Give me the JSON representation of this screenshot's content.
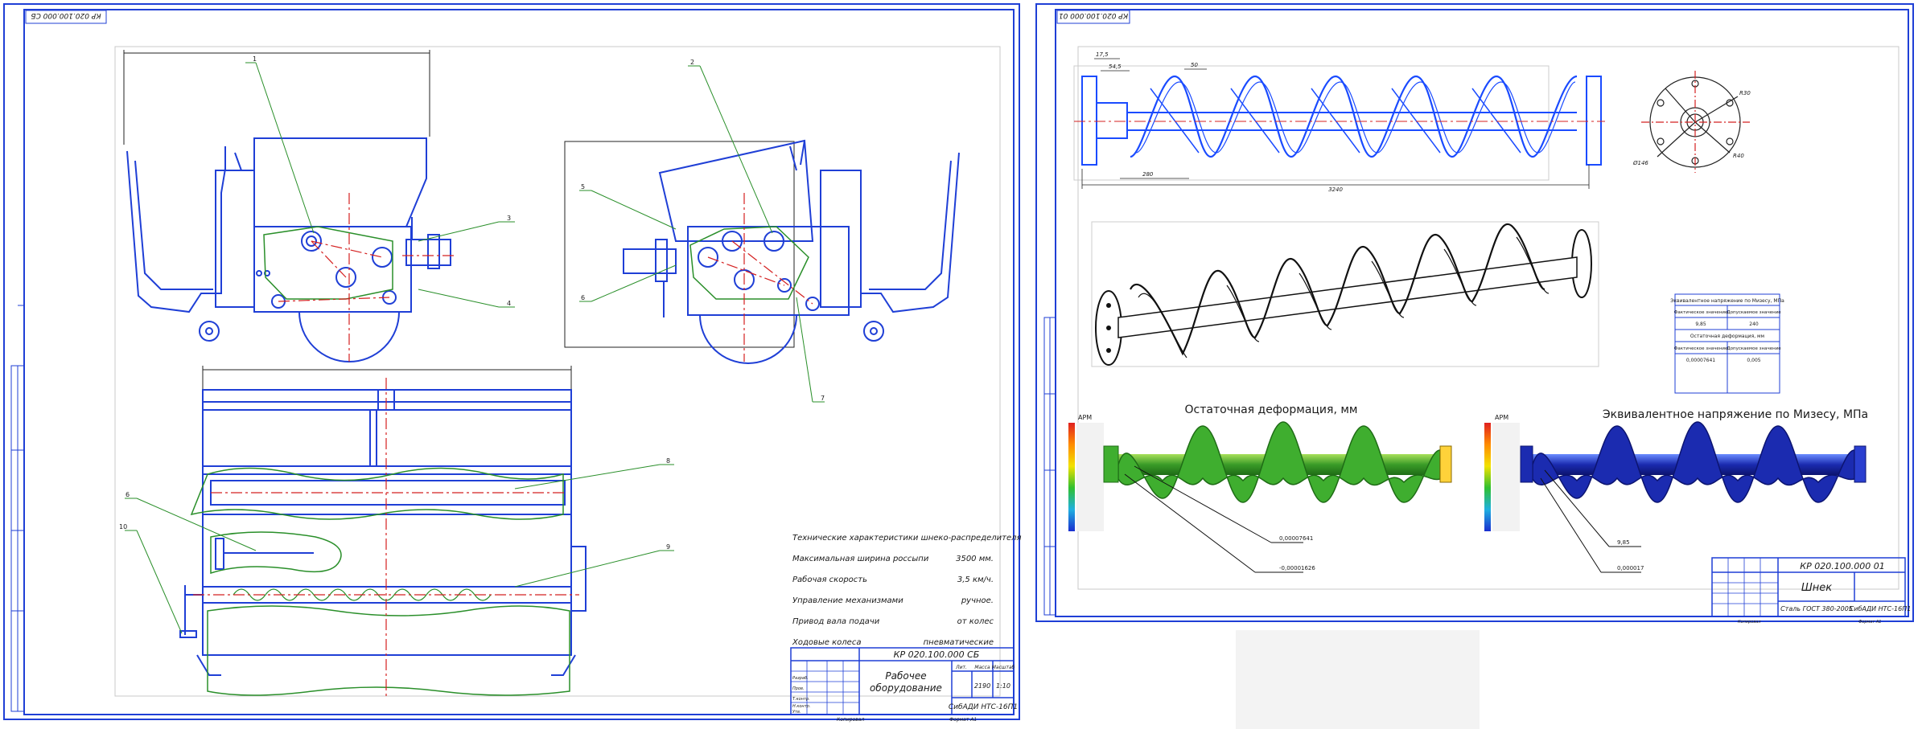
{
  "sheet1": {
    "stamp": "КР 020.100.000 СБ",
    "title_block": {
      "code": "КР 020.100.000 СБ",
      "name_line1": "Рабочее",
      "name_line2": "оборудование",
      "org": "СибАДИ  НТС-16П1",
      "mass": "2190",
      "scale": "1:10",
      "hdr_lit": "Лит.",
      "hdr_mass": "Масса",
      "hdr_scale": "Масштаб",
      "row_razrab": "Разраб.",
      "row_prov": "Пров.",
      "row_tkontr": "Т.контр.",
      "row_nkontr": "Н.контр.",
      "row_utv": "Утв.",
      "copy": "Копировал",
      "format": "Формат  А1"
    },
    "tech_title": "Технические характеристики шнеко-распределителя",
    "tech": [
      {
        "label": "Максимальная ширина россыпи",
        "value": "3500 мм."
      },
      {
        "label": "Рабочая скорость",
        "value": "3,5 км/ч."
      },
      {
        "label": "Управление механизмами",
        "value": "ручное."
      },
      {
        "label": "Привод вала подачи",
        "value": "от колес"
      },
      {
        "label": "Ходовые колеса",
        "value": "пневматические"
      }
    ],
    "callouts": [
      "1",
      "2",
      "3",
      "4",
      "5",
      "6",
      "7",
      "8",
      "9",
      "10"
    ]
  },
  "sheet2": {
    "stamp": "КР 020.100.000 01",
    "title_block": {
      "code": "КР 020.100.000 01",
      "name": "Шнек",
      "material": "Сталь  ГОСТ 380-2005",
      "org": "СибАДИ  НТС-16П1",
      "copy": "Копировал",
      "format": "Формат  А1"
    },
    "dims": {
      "total": "3240",
      "pitch": "280",
      "d1": "17,5",
      "d2": "54,5",
      "d3": "50",
      "r1": "R30",
      "r2": "R40",
      "phi": "Ø146"
    },
    "table": {
      "header": "Эквивалентное напряжение по Мизесу, МПа",
      "rows": [
        [
          "Фактическое значение",
          "Допускаемое значение"
        ],
        [
          "9,85",
          "240"
        ],
        [
          "Остаточная деформация, мм",
          ""
        ],
        [
          "Фактическое значение",
          "Допускаемое значение"
        ],
        [
          "0,00007641",
          "0,005"
        ]
      ]
    },
    "fea_left_title": "Остаточная деформация, мм",
    "fea_right_title": "Эквивалентное напряжение по Мизесу, МПа",
    "fea_left_callouts": [
      "0,00007641",
      "-0,00001626"
    ],
    "fea_right_callouts": [
      "9,85",
      "0,000017"
    ],
    "legend_brand": "APM",
    "colors": {
      "frame": "#1f3fd6",
      "green_outline": "#2a8f2a",
      "red_centerline": "#d42020",
      "auger_blue": "#1a4bff",
      "fea_green": "#3fae2f",
      "fea_blue": "#1b2bb0"
    }
  }
}
